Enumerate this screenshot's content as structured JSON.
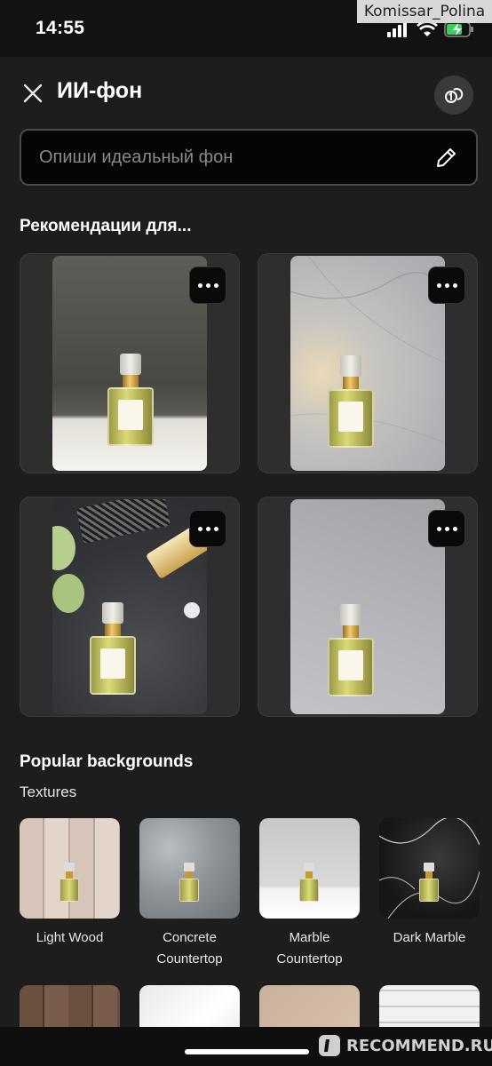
{
  "status": {
    "time": "14:55",
    "watermark": "Komissar_Polina"
  },
  "header": {
    "title": "ИИ-фон"
  },
  "prompt": {
    "placeholder": "Опиши идеальный фон"
  },
  "recommendations": {
    "title": "Рекомендации для..."
  },
  "popular": {
    "title": "Popular backgrounds",
    "subtitle": "Textures",
    "items": [
      {
        "label_line1": "Light Wood",
        "label_line2": ""
      },
      {
        "label_line1": "Concrete",
        "label_line2": "Countertop"
      },
      {
        "label_line1": "Marble",
        "label_line2": "Countertop"
      },
      {
        "label_line1": "Dark Marble",
        "label_line2": ""
      }
    ]
  },
  "footer": {
    "watermark": "RECOMMEND.RU"
  },
  "colors": {
    "background": "#1d1d1d",
    "card": "#2e2e2e",
    "input_bg": "#050505"
  }
}
